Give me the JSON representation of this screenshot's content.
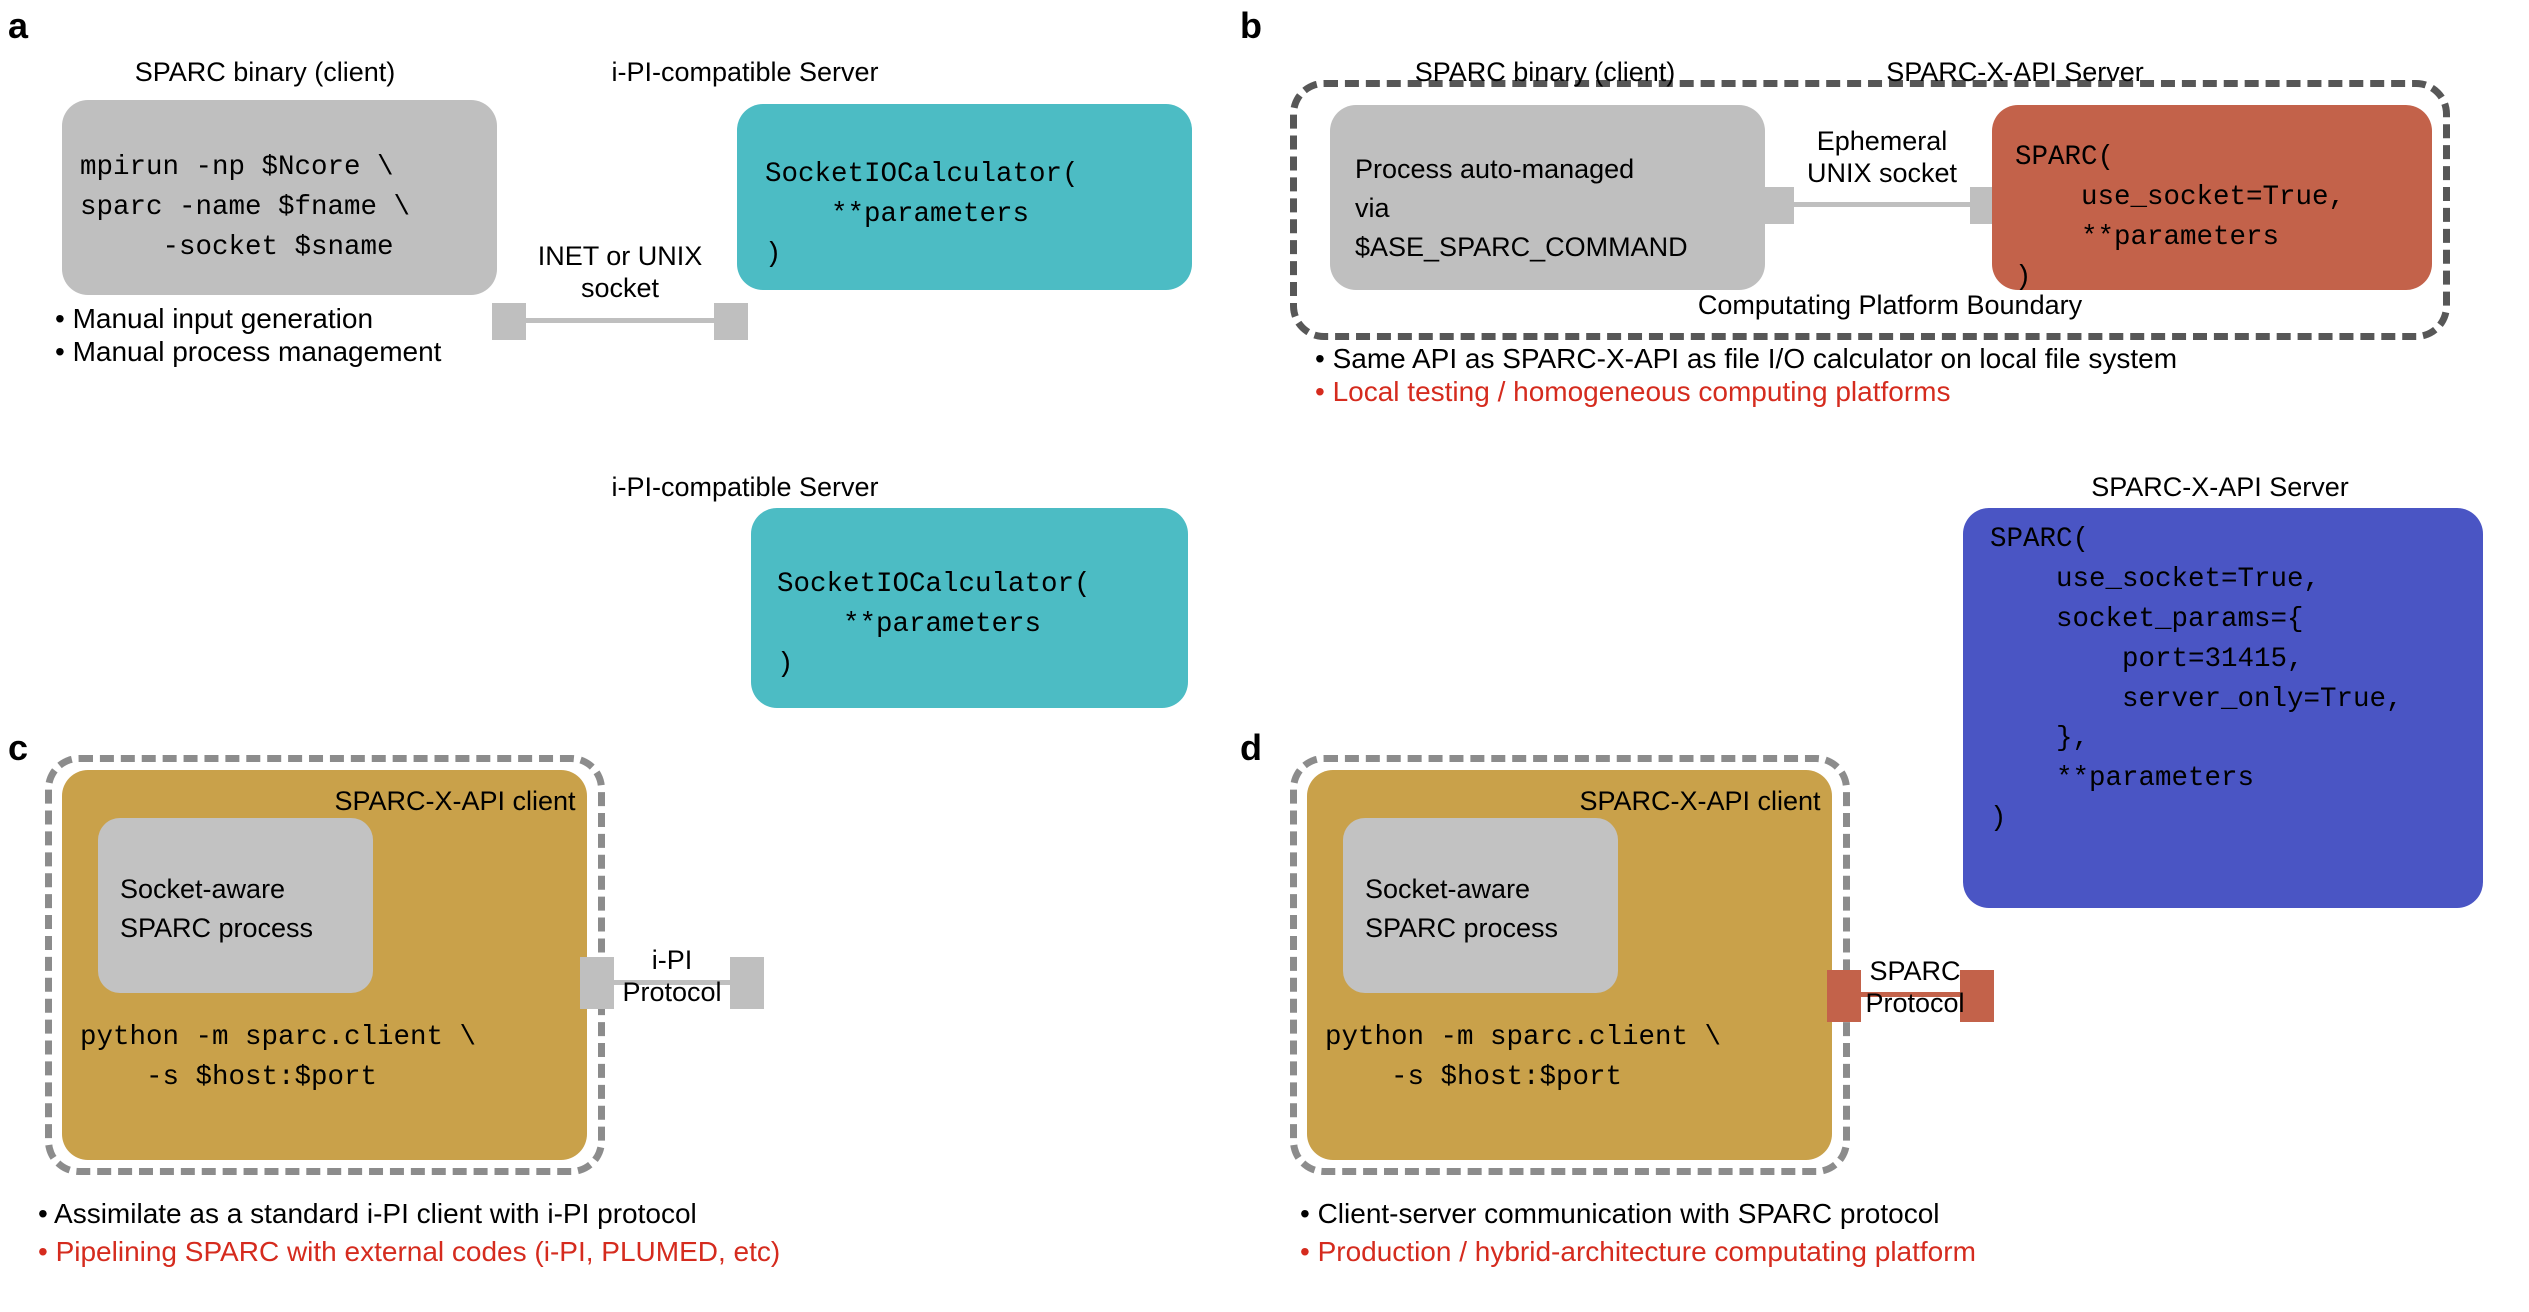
{
  "figure": {
    "panels": [
      {
        "letter": "a",
        "client_box": {
          "title": "SPARC binary (client)",
          "code": "mpirun -np $Ncore \\\nsparc -name $fname \\\n     -socket $sname"
        },
        "server_box": {
          "title": "i-PI-compatible Server",
          "code": "SocketIOCalculator(\n    **parameters\n)"
        },
        "connector_label": "INET or UNIX\nsocket",
        "bullets": [
          {
            "text": "• Manual input generation",
            "color": "#000000"
          },
          {
            "text": "• Manual process management",
            "color": "#000000"
          }
        ]
      },
      {
        "letter": "b",
        "client_box": {
          "title": "SPARC binary (client)",
          "code": "Process auto-managed\nvia\n$ASE_SPARC_COMMAND"
        },
        "server_box": {
          "title": "SPARC-X-API Server",
          "code": "SPARC(\n    use_socket=True,\n    **parameters\n)"
        },
        "connector_label": "Ephemeral\nUNIX socket",
        "boundary_label": "Computating Platform Boundary",
        "bullets": [
          {
            "text": "• Same API as SPARC-X-API as file I/O calculator on local file system",
            "color": "#000000"
          },
          {
            "text": "• Local testing / homogeneous computing platforms",
            "color": "#d52b1e"
          }
        ]
      },
      {
        "letter": "c",
        "client_box": {
          "title": "SPARC-X-API\nclient",
          "inner_label": "Socket-aware\nSPARC process",
          "code": "python -m sparc.client \\\n    -s $host:$port"
        },
        "server_box": {
          "title": "i-PI-compatible Server",
          "code": "SocketIOCalculator(\n    **parameters\n)"
        },
        "connector_label": "i-PI\nProtocol",
        "bullets": [
          {
            "text": "• Assimilate as a standard i-PI client with i-PI protocol",
            "color": "#000000"
          },
          {
            "text": "• Pipelining SPARC with external codes (i-PI, PLUMED, etc)",
            "color": "#d52b1e"
          }
        ]
      },
      {
        "letter": "d",
        "client_box": {
          "title": "SPARC-X-API\nclient",
          "inner_label": "Socket-aware\nSPARC process",
          "code": "python -m sparc.client \\\n    -s $host:$port"
        },
        "server_box": {
          "title": "SPARC-X-API Server",
          "code": "SPARC(\n    use_socket=True,\n    socket_params={\n        port=31415,\n        server_only=True,\n    },\n    **parameters\n)"
        },
        "connector_label": "SPARC\nProtocol",
        "bullets": [
          {
            "text": "• Client-server communication with SPARC protocol",
            "color": "#000000"
          },
          {
            "text": "• Production / hybrid-architecture computating platform",
            "color": "#d52b1e"
          }
        ]
      }
    ],
    "colors": {
      "gray_box": "#bfbfbf",
      "teal_box": "#4cbcc4",
      "red_box": "#c3624a",
      "gold_box": "#c9a14a",
      "blue_box": "#4a55c4",
      "dashed_dark": "#575757",
      "dashed_light": "#8c8c8c",
      "highlight_text": "#d52b1e"
    }
  }
}
